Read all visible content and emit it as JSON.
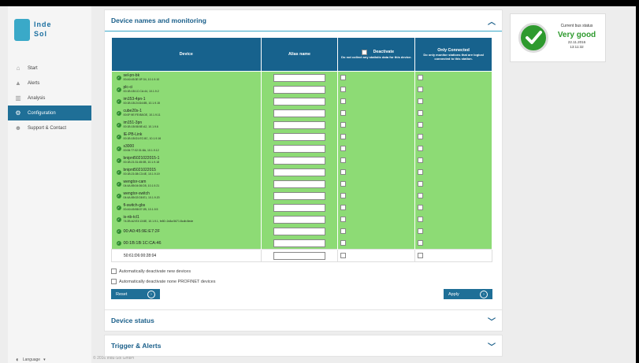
{
  "logo": {
    "text_line1": "Inde",
    "text_line2": "Sol"
  },
  "sidebar": {
    "items": [
      {
        "label": "Start",
        "icon": "home-icon"
      },
      {
        "label": "Alerts",
        "icon": "bell-icon"
      },
      {
        "label": "Analysis",
        "icon": "chart-icon"
      },
      {
        "label": "Configuration",
        "icon": "gears-icon",
        "active": true
      },
      {
        "label": "Support & Contact",
        "icon": "people-icon"
      }
    ]
  },
  "footer": {
    "language": "Language",
    "copyright": "© 2016 Indu-Sol GmbH"
  },
  "panel_devices": {
    "title": "Device names and monitoring",
    "columns": {
      "device": "Device",
      "alias": "Alias name",
      "deactivate": "Deactivate",
      "deactivate_sub": "Do not collect any statistic data for this device.",
      "only_connected": "Only Connected",
      "only_connected_sub": "Do only monitor stations that are logical connected to this station."
    },
    "rows": [
      {
        "name": "sel-pn-bk",
        "mac": "00:A0:45:3E:0F:34, 10.1.9.10"
      },
      {
        "name": "plc-ci",
        "mac": "00:1B:1B:1C:CA:44, 10.1.9.2"
      },
      {
        "name": "im153-4pn-1",
        "mac": "00:1B:1B:24:D4:8B, 10.1.9.15"
      },
      {
        "name": "cube20s-1",
        "mac": "00:0F:9E:FE:B8:DE, 10.1.9.11"
      },
      {
        "name": "im151-3pn",
        "mac": "00:1B:1B:58:5E:A2, 10.1.9.6"
      },
      {
        "name": "IE-PB-Link",
        "mac": "00:1B:1B:D1:EC:8C, 10.1.9.16"
      },
      {
        "name": "s3000",
        "mac": "00:06:77:02:31:8A, 10.1.9.12"
      },
      {
        "name": "bnipnt5021022015-1",
        "mac": "00:1B:21:31:45:0B, 10.1.9.18"
      },
      {
        "name": "bnipnt5021022015",
        "mac": "00:1B:21:08:C3:4E, 10.1.9.19"
      },
      {
        "name": "wengtor-cam",
        "mac": "04:4A:85:04:06:D5, 10.1.9.21"
      },
      {
        "name": "wengtor-switch",
        "mac": "04:4A:85:02:D8:E1, 10.1.9.20"
      },
      {
        "name": "fl-switch-gbs",
        "mac": "00:A0:45:B8:07:2B, 10.1.9.5"
      },
      {
        "name": "is-nb-tcl1",
        "mac": "74:2B:A2:E3:13:8E, 10.1.9.1, fe80::2c8a:5671:8cdb:8ede"
      },
      {
        "name": "00:A0:45:9E:E7:2F",
        "mac": ""
      },
      {
        "name": "00:1B:1B:1C:CA:46",
        "mac": ""
      },
      {
        "name": "50:61:D6:00:28:04",
        "mac": ""
      }
    ],
    "opt_new": "Automatically deactivate new devices",
    "opt_profinet": "Automatically deactivate none PROFINET devices",
    "reset": "Reset",
    "apply": "Apply"
  },
  "panel_status": {
    "title": "Device status"
  },
  "panel_trigger": {
    "title": "Trigger & Alerts"
  },
  "bus_status": {
    "label": "Current bus status",
    "value": "Very good",
    "date": "22.11.2016",
    "time": "13:11:32",
    "color": "#2e9a2e"
  }
}
